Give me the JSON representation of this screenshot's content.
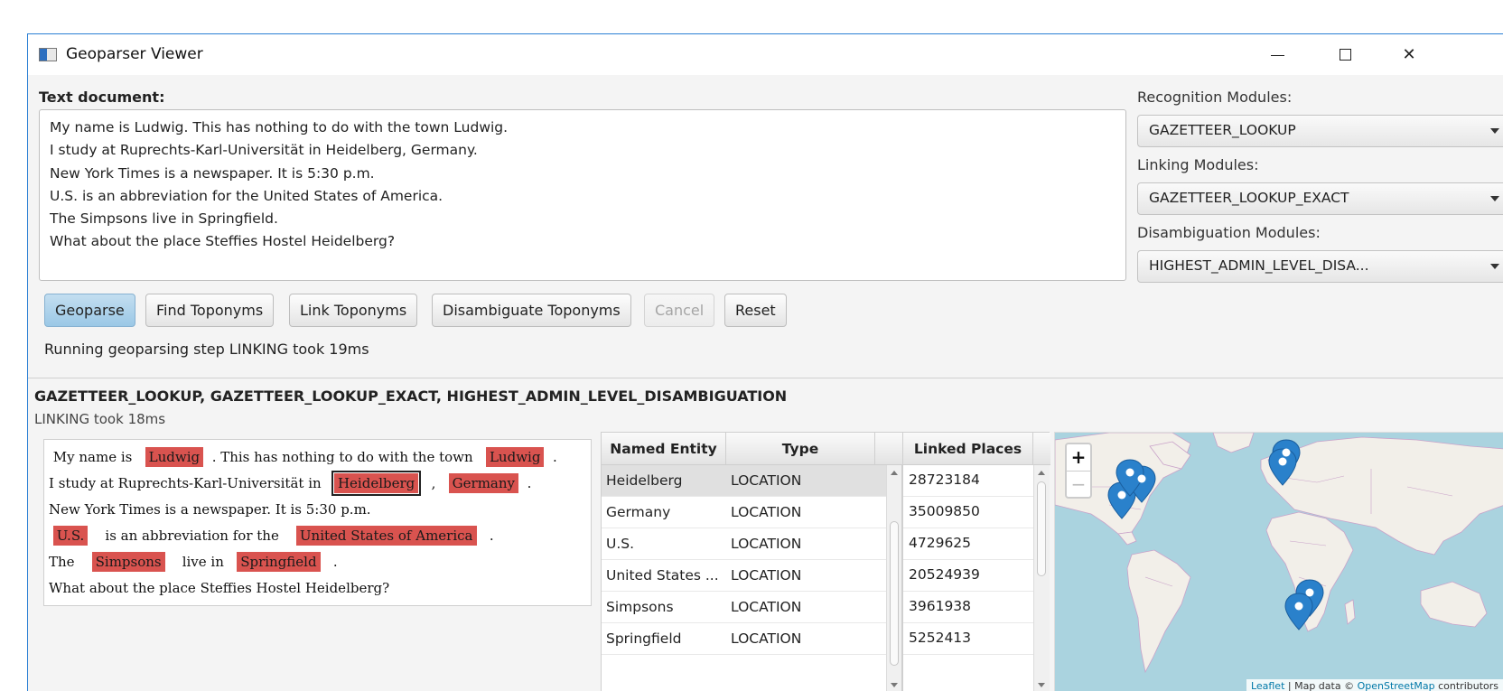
{
  "window": {
    "title": "Geoparser Viewer",
    "min_icon": "minimize-icon",
    "max_icon": "maximize-icon",
    "close_label": "✕"
  },
  "input": {
    "label": "Text document:",
    "lines": [
      "My name is Ludwig. This has nothing to do with the town Ludwig.",
      "I study at Ruprechts-Karl-Universität in Heidelberg, Germany.",
      "New York Times is a newspaper. It is 5:30 p.m.",
      "U.S. is an abbreviation for the United States of America.",
      "The Simpsons live in Springfield.",
      "What about the place Steffies Hostel Heidelberg?"
    ]
  },
  "modules": {
    "recognition_label": "Recognition Modules:",
    "recognition_value": "GAZETTEER_LOOKUP",
    "linking_label": "Linking Modules:",
    "linking_value": "GAZETTEER_LOOKUP_EXACT",
    "disambiguation_label": "Disambiguation Modules:",
    "disambiguation_value": "HIGHEST_ADMIN_LEVEL_DISA..."
  },
  "buttons": {
    "geoparse": "Geoparse",
    "find": "Find Toponyms",
    "link": "Link Toponyms",
    "disambiguate": "Disambiguate Toponyms",
    "cancel": "Cancel",
    "reset": "Reset"
  },
  "status": "Running geoparsing step LINKING took 19ms",
  "result": {
    "title": "GAZETTEER_LOOKUP, GAZETTEER_LOOKUP_EXACT, HIGHEST_ADMIN_LEVEL_DISAMBIGUATION",
    "subtitle": "LINKING took 18ms",
    "doc": {
      "l1a": "My name is",
      "l1b": "Ludwig",
      "l1c": ". This has nothing to do with the town",
      "l1d": "Ludwig",
      "l1e": ".",
      "l2a": "I study at Ruprechts-Karl-Universität in",
      "l2b": "Heidelberg",
      "l2c": ",",
      "l2d": "Germany",
      "l2e": ".",
      "l3": "New York Times is a newspaper. It is 5:30 p.m.",
      "l4a": "U.S.",
      "l4b": "is an abbreviation for the",
      "l4c": "United States of America",
      "l4d": ".",
      "l5a": "The",
      "l5b": "Simpsons",
      "l5c": "live in",
      "l5d": "Springfield",
      "l5e": ".",
      "l6": "What about the place Steffies Hostel Heidelberg?"
    }
  },
  "entities": {
    "col_entity": "Named Entity",
    "col_type": "Type",
    "rows": [
      {
        "entity": "Heidelberg",
        "type": "LOCATION"
      },
      {
        "entity": "Germany",
        "type": "LOCATION"
      },
      {
        "entity": "U.S.",
        "type": "LOCATION"
      },
      {
        "entity": "United States ...",
        "type": "LOCATION"
      },
      {
        "entity": "Simpsons",
        "type": "LOCATION"
      },
      {
        "entity": "Springfield",
        "type": "LOCATION"
      }
    ]
  },
  "places": {
    "col": "Linked Places",
    "rows": [
      "28723184",
      "35009850",
      "4729625",
      "20524939",
      "3961938",
      "5252413"
    ]
  },
  "map": {
    "zoom_in": "+",
    "zoom_out": "−",
    "attrib_leaflet": "Leaflet",
    "attrib_mid": " | Map data © ",
    "attrib_osm": "OpenStreetMap",
    "attrib_end": " contributors",
    "marker_color": "#2a81cb",
    "water_color": "#aad3df",
    "land_color": "#f2efe9"
  },
  "colors": {
    "highlight": "#d9534f",
    "primary_button": "#a8cfe9",
    "window_border": "#2b7fd4"
  }
}
